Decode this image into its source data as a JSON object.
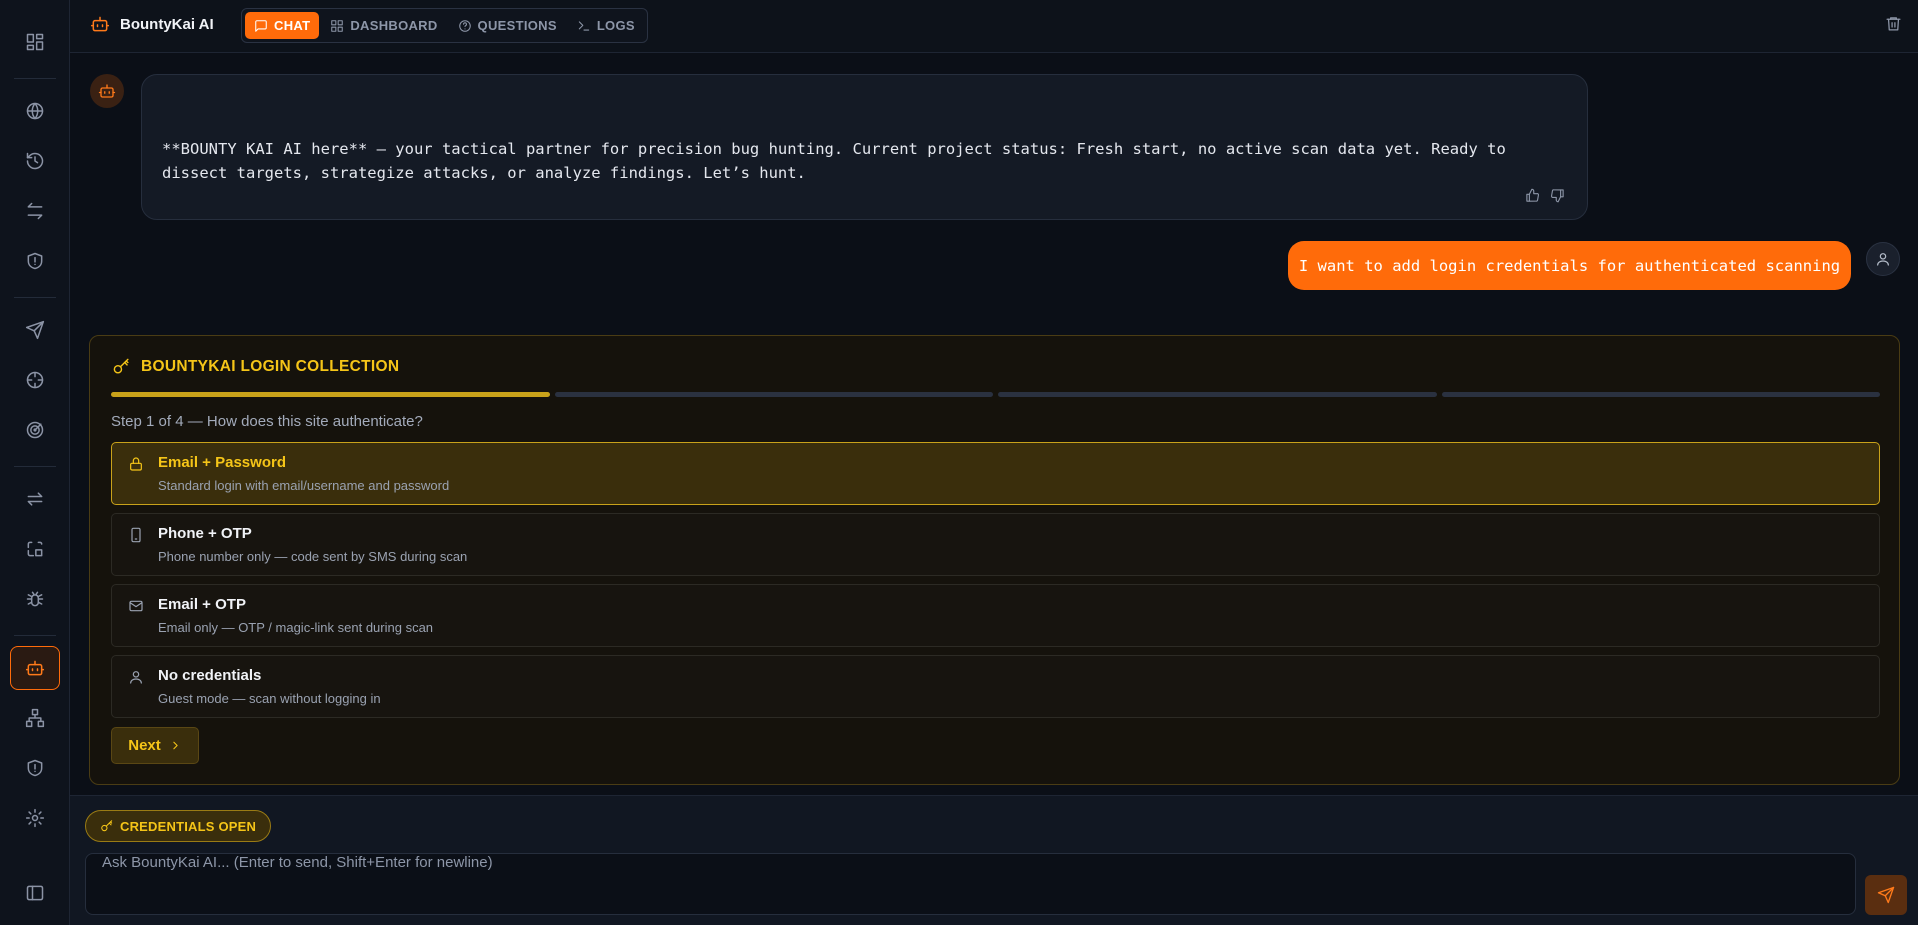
{
  "app": {
    "name": "BountyKai AI",
    "brand_icon": "bot-icon"
  },
  "tabs": [
    {
      "label": "CHAT",
      "icon": "chat-icon",
      "active": true
    },
    {
      "label": "DASHBOARD",
      "icon": "dashboard-icon",
      "active": false
    },
    {
      "label": "QUESTIONS",
      "icon": "help-circle-icon",
      "active": false
    },
    {
      "label": "LOGS",
      "icon": "terminal-icon",
      "active": false
    }
  ],
  "sidebar": {
    "items": [
      {
        "icon": "grid-icon"
      },
      {
        "icon": "globe-icon"
      },
      {
        "icon": "history-icon"
      },
      {
        "icon": "arrows-swap-icon"
      },
      {
        "icon": "shield-icon"
      },
      {
        "icon": "send-icon"
      },
      {
        "icon": "crosshair-icon"
      },
      {
        "icon": "target-icon"
      },
      {
        "icon": "repeat-icon"
      },
      {
        "icon": "scan-code-icon"
      },
      {
        "icon": "bug-icon"
      },
      {
        "icon": "bot-icon",
        "active": true
      },
      {
        "icon": "network-icon"
      },
      {
        "icon": "shield-alert-icon"
      },
      {
        "icon": "settings-icon"
      },
      {
        "icon": "panel-icon"
      }
    ]
  },
  "messages": {
    "bot": {
      "text": "**BOUNTY KAI AI here** — your tactical partner for precision bug hunting. Current project status: Fresh start, no active scan data yet. Ready to dissect targets, strategize attacks, or analyze findings. Let’s hunt."
    },
    "user": {
      "text": "I want to add login credentials for authenticated scanning"
    }
  },
  "login_collection": {
    "title": "BOUNTYKAI LOGIN COLLECTION",
    "progress": {
      "current": 1,
      "total": 4
    },
    "step_label": "Step 1 of 4 — How does this site authenticate?",
    "options": [
      {
        "title": "Email + Password",
        "desc": "Standard login with email/username and password",
        "icon": "lock-icon",
        "selected": true
      },
      {
        "title": "Phone + OTP",
        "desc": "Phone number only — code sent by SMS during scan",
        "icon": "phone-icon",
        "selected": false
      },
      {
        "title": "Email + OTP",
        "desc": "Email only — OTP / magic-link sent during scan",
        "icon": "mail-icon",
        "selected": false
      },
      {
        "title": "No credentials",
        "desc": "Guest mode — scan without logging in",
        "icon": "user-icon",
        "selected": false
      }
    ],
    "next_label": "Next"
  },
  "composer": {
    "badge": "CREDENTIALS OPEN",
    "placeholder": "Ask BountyKai AI... (Enter to send, Shift+Enter for newline)",
    "value": ""
  },
  "colors": {
    "accent": "#ff6b0a",
    "gold": "#f5c518",
    "background": "#0b0f17"
  }
}
